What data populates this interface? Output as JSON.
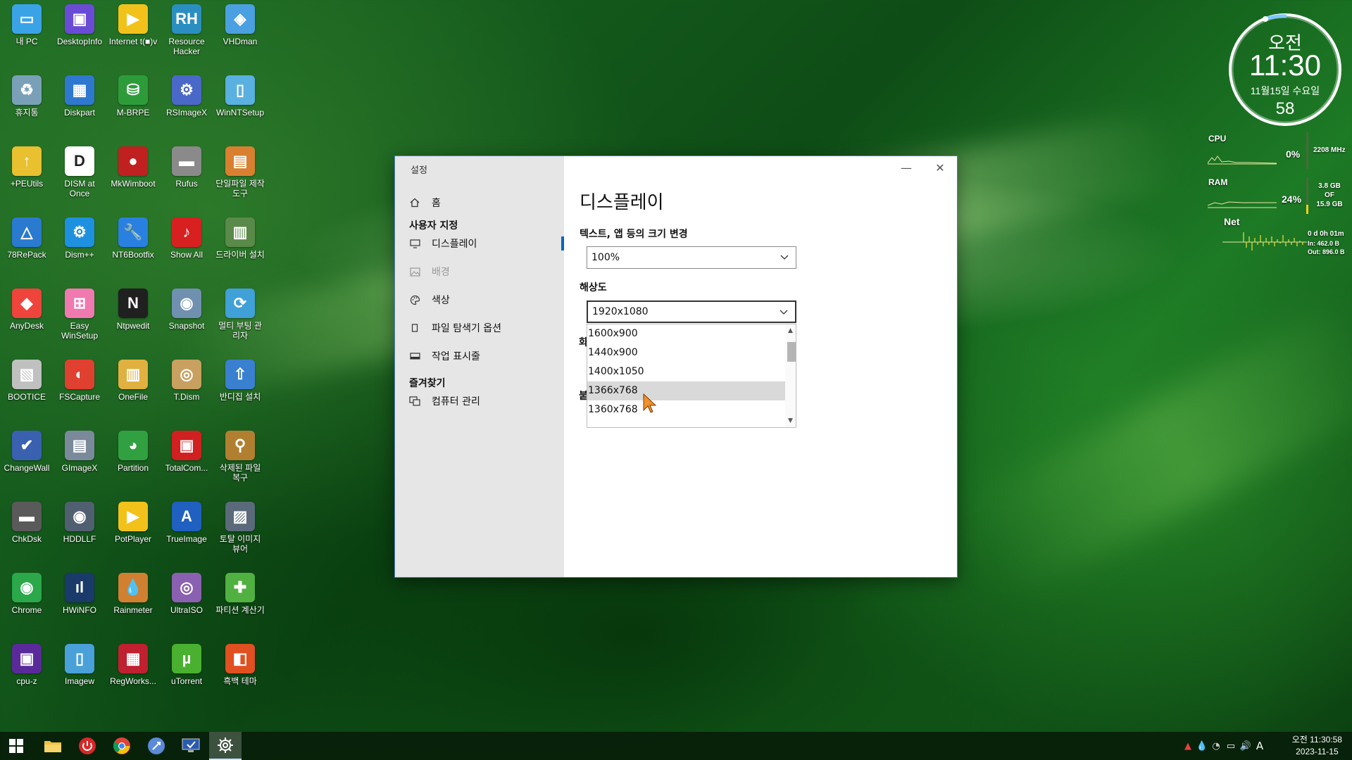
{
  "desktop": {
    "icons": [
      {
        "label": "내 PC",
        "icon": "monitor-icon",
        "color": "#3aa3e8",
        "glyph": "▭"
      },
      {
        "label": "DesktopInfo",
        "icon": "desktopinfo-icon",
        "color": "#6a4bd6",
        "glyph": "▣"
      },
      {
        "label": "Internet t(■)v",
        "icon": "player-icon",
        "color": "#f2c21a",
        "glyph": "▶"
      },
      {
        "label": "Resource Hacker",
        "icon": "rh-icon",
        "color": "#2a8fc0",
        "glyph": "RH"
      },
      {
        "label": "VHDman",
        "icon": "vhd-icon",
        "color": "#4aa0e0",
        "glyph": "◈"
      },
      {
        "label": "휴지통",
        "icon": "recycle-bin-icon",
        "color": "#7aa0b8",
        "glyph": "♻"
      },
      {
        "label": "Diskpart",
        "icon": "diskpart-icon",
        "color": "#2f78d0",
        "glyph": "▦"
      },
      {
        "label": "M-BRPE",
        "icon": "disk-icon",
        "color": "#2e9b3a",
        "glyph": "⛁"
      },
      {
        "label": "RSImageX",
        "icon": "rsimagex-icon",
        "color": "#4a68c8",
        "glyph": "⚙"
      },
      {
        "label": "WinNTSetup",
        "icon": "winntsetup-icon",
        "color": "#5ab0e0",
        "glyph": "▯"
      },
      {
        "label": "+PEUtils",
        "icon": "peutils-icon",
        "color": "#e8c030",
        "glyph": "↑"
      },
      {
        "label": "DISM at Once",
        "icon": "dism-icon",
        "color": "#ffffff",
        "glyph": "D"
      },
      {
        "label": "MkWimboot",
        "icon": "ladybug-icon",
        "color": "#c02020",
        "glyph": "●"
      },
      {
        "label": "Rufus",
        "icon": "usb-icon",
        "color": "#8a8a8a",
        "glyph": "▬"
      },
      {
        "label": "단일파일 제작도구",
        "icon": "box-icon",
        "color": "#d88030",
        "glyph": "▤"
      },
      {
        "label": "78RePack",
        "icon": "triangle-icon",
        "color": "#2a7ad0",
        "glyph": "△"
      },
      {
        "label": "Dism++",
        "icon": "gears-icon",
        "color": "#1e90e0",
        "glyph": "⚙"
      },
      {
        "label": "NT6Bootfix",
        "icon": "wrench-icon",
        "color": "#2a80e0",
        "glyph": "🔧"
      },
      {
        "label": "Show All",
        "icon": "show-all-icon",
        "color": "#d82020",
        "glyph": "♪"
      },
      {
        "label": "드라이버 설치",
        "icon": "driver-icon",
        "color": "#5a8a4a",
        "glyph": "▥"
      },
      {
        "label": "AnyDesk",
        "icon": "anydesk-icon",
        "color": "#ef443b",
        "glyph": "◆"
      },
      {
        "label": "Easy WinSetup",
        "icon": "easy-winsetup-icon",
        "color": "#f07ab0",
        "glyph": "⊞"
      },
      {
        "label": "Ntpwedit",
        "icon": "ntpwedit-icon",
        "color": "#202020",
        "glyph": "N"
      },
      {
        "label": "Snapshot",
        "icon": "snapshot-icon",
        "color": "#7090b0",
        "glyph": "◉"
      },
      {
        "label": "멀티 부팅 관리자",
        "icon": "multiboot-icon",
        "color": "#40a0d8",
        "glyph": "⟳"
      },
      {
        "label": "BOOTICE",
        "icon": "bootice-icon",
        "color": "#c0c0c0",
        "glyph": "▧"
      },
      {
        "label": "FSCapture",
        "icon": "fscapture-icon",
        "color": "#e04030",
        "glyph": "◐"
      },
      {
        "label": "OneFile",
        "icon": "onefile-icon",
        "color": "#e0b040",
        "glyph": "▥"
      },
      {
        "label": "T.Dism",
        "icon": "tdism-icon",
        "color": "#c8a060",
        "glyph": "◎"
      },
      {
        "label": "반디집 설치",
        "icon": "bandizip-icon",
        "color": "#3a80d0",
        "glyph": "⇧"
      },
      {
        "label": "ChangeWall",
        "icon": "changewall-icon",
        "color": "#3a60b0",
        "glyph": "✔"
      },
      {
        "label": "GImageX",
        "icon": "gimagex-icon",
        "color": "#7a8a9a",
        "glyph": "▤"
      },
      {
        "label": "Partition",
        "icon": "partition-icon",
        "color": "#30a040",
        "glyph": "◕"
      },
      {
        "label": "TotalCom...",
        "icon": "floppy-icon",
        "color": "#d02020",
        "glyph": "▣"
      },
      {
        "label": "삭제된 파일 복구",
        "icon": "recovery-icon",
        "color": "#b08030",
        "glyph": "⚲"
      },
      {
        "label": "ChkDsk",
        "icon": "chkdsk-icon",
        "color": "#5a5a5a",
        "glyph": "▬"
      },
      {
        "label": "HDDLLF",
        "icon": "hddllf-icon",
        "color": "#506070",
        "glyph": "◉"
      },
      {
        "label": "PotPlayer",
        "icon": "potplayer-icon",
        "color": "#f2c21a",
        "glyph": "▶"
      },
      {
        "label": "TrueImage",
        "icon": "trueimage-icon",
        "color": "#2060c0",
        "glyph": "A"
      },
      {
        "label": "토탈 이미지 뷰어",
        "icon": "image-viewer-icon",
        "color": "#5a6a7a",
        "glyph": "▨"
      },
      {
        "label": "Chrome",
        "icon": "chrome-icon",
        "color": "#2aa84a",
        "glyph": "◉"
      },
      {
        "label": "HWiNFO",
        "icon": "hwinfo-icon",
        "color": "#1a3a6a",
        "glyph": "ıl"
      },
      {
        "label": "Rainmeter",
        "icon": "rainmeter-icon",
        "color": "#d08030",
        "glyph": "💧"
      },
      {
        "label": "UltraISO",
        "icon": "ultraiso-icon",
        "color": "#8a60b0",
        "glyph": "◎"
      },
      {
        "label": "파티션 계산기",
        "icon": "puzzle-icon",
        "color": "#50b040",
        "glyph": "✚"
      },
      {
        "label": "cpu-z",
        "icon": "cpuz-icon",
        "color": "#5a2a9a",
        "glyph": "▣"
      },
      {
        "label": "Imagew",
        "icon": "imagew-icon",
        "color": "#4aa0d8",
        "glyph": "▯"
      },
      {
        "label": "RegWorks...",
        "icon": "regworks-icon",
        "color": "#c02030",
        "glyph": "▦"
      },
      {
        "label": "uTorrent",
        "icon": "utorrent-icon",
        "color": "#4ab030",
        "glyph": "µ"
      },
      {
        "label": "흑백 테마",
        "icon": "theme-icon",
        "color": "#e05020",
        "glyph": "◧"
      }
    ]
  },
  "settings": {
    "window_title": "설정",
    "minimize_glyph": "—",
    "close_glyph": "✕",
    "sidebar": {
      "home": {
        "label": "홈",
        "icon": "home-icon"
      },
      "section_custom": "사용자 지정",
      "items": [
        {
          "label": "디스플레이",
          "icon": "display-icon",
          "selected": true,
          "disabled": false
        },
        {
          "label": "배경",
          "icon": "background-image-icon",
          "selected": false,
          "disabled": true
        },
        {
          "label": "색상",
          "icon": "palette-icon",
          "selected": false,
          "disabled": false
        },
        {
          "label": "파일 탐색기 옵션",
          "icon": "file-explorer-icon",
          "selected": false,
          "disabled": false
        },
        {
          "label": "작업 표시줄",
          "icon": "taskbar-icon",
          "selected": false,
          "disabled": false
        }
      ],
      "section_favorites": "즐겨찾기",
      "favorites": [
        {
          "label": "컴퓨터 관리",
          "icon": "computer-management-icon"
        }
      ]
    },
    "main": {
      "title": "디스플레이",
      "scale_label": "텍스트, 앱 등의 크기 변경",
      "scale_value": "100%",
      "resolution_label": "해상도",
      "resolution_value": "1920x1080",
      "resolution_options": [
        "1600x900",
        "1440x900",
        "1400x1050",
        "1366x768",
        "1360x768"
      ],
      "hovered_option": "1366x768",
      "hidden_label_char_1": "화",
      "hidden_label_char_2": "붙"
    }
  },
  "clock_widget": {
    "ampm": "오전",
    "time": "11:30",
    "date": "11월15일 수요일",
    "seconds": "58"
  },
  "system_monitor": {
    "cpu_label": "CPU",
    "cpu_percent": "0%",
    "cpu_freq": "2208 MHz",
    "ram_label": "RAM",
    "ram_percent": "24%",
    "ram_used": "3.8 GB",
    "ram_of": "OF",
    "ram_total": "15.9 GB",
    "net_label": "Net",
    "net_uptime": "0 d 0h 01m",
    "net_in": "In: 462.0 B",
    "net_out": "Out: 896.0 B"
  },
  "taskbar": {
    "buttons": [
      {
        "name": "start-button",
        "icon": "windows-logo-icon",
        "active": false
      },
      {
        "name": "file-explorer-button",
        "icon": "folder-icon",
        "active": false
      },
      {
        "name": "power-button",
        "icon": "power-icon",
        "active": false
      },
      {
        "name": "chrome-button",
        "icon": "chrome-icon",
        "active": false
      },
      {
        "name": "launcher-button",
        "icon": "rocket-icon",
        "active": false
      },
      {
        "name": "changewall-button",
        "icon": "monitor-check-icon",
        "active": false
      },
      {
        "name": "settings-button",
        "icon": "gear-icon",
        "active": true
      }
    ],
    "tray_icons": [
      "network-alert-icon",
      "droplet-icon",
      "wifi-icon",
      "battery-icon",
      "volume-icon"
    ],
    "ime": "A",
    "time": "오전 11:30:58",
    "date": "2023-11-15"
  }
}
